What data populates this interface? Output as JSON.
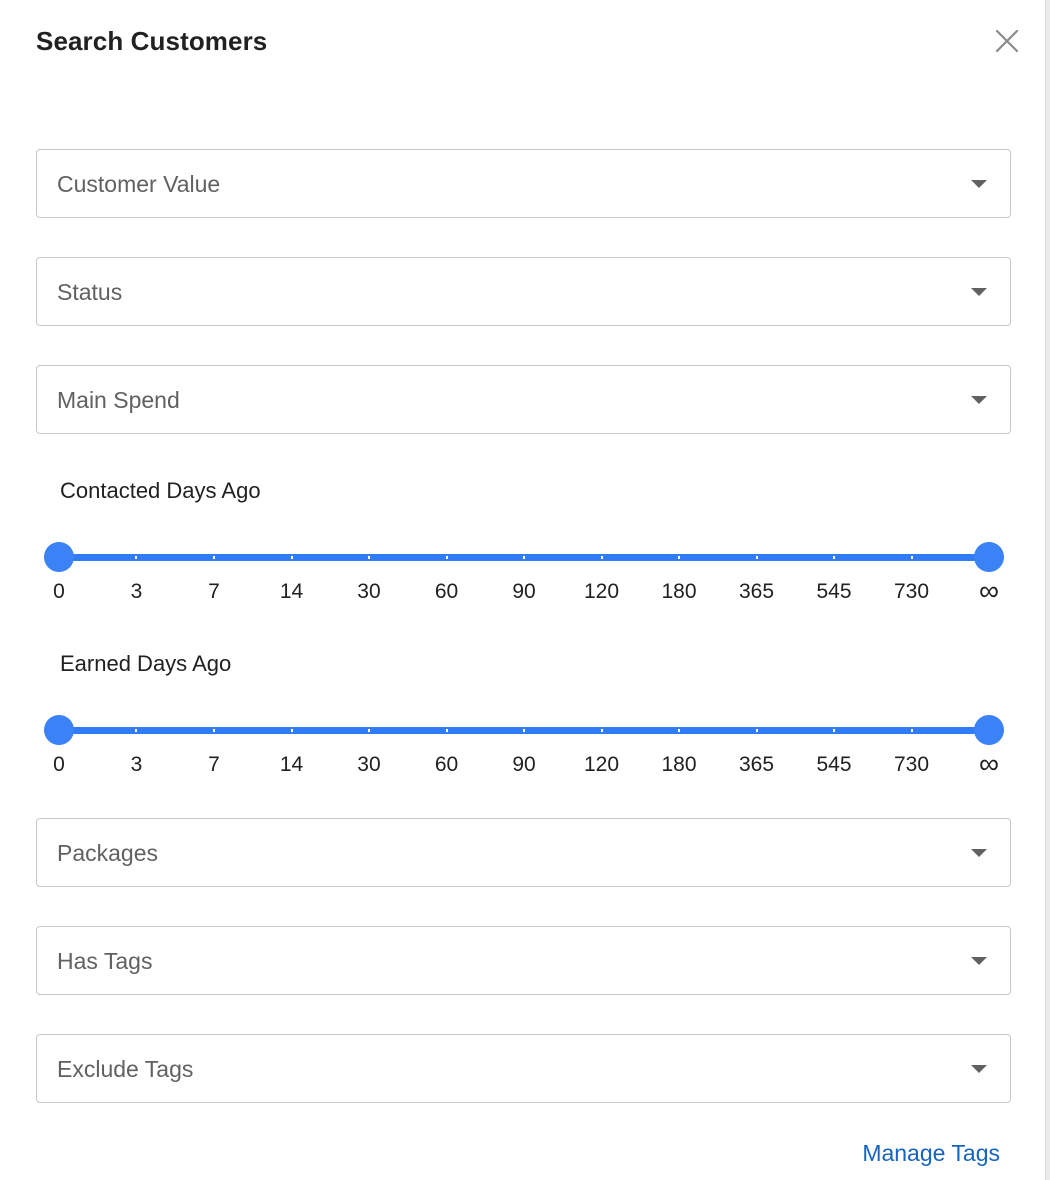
{
  "dialog": {
    "title": "Search Customers",
    "close_icon": "close-icon"
  },
  "filters": {
    "customer_value": {
      "label": "Customer Value",
      "icon": "chevron-down-icon"
    },
    "status": {
      "label": "Status",
      "icon": "chevron-down-icon"
    },
    "main_spend": {
      "label": "Main Spend",
      "icon": "chevron-down-icon"
    },
    "packages": {
      "label": "Packages",
      "icon": "chevron-down-icon"
    },
    "has_tags": {
      "label": "Has Tags",
      "icon": "chevron-down-icon"
    },
    "exclude_tags": {
      "label": "Exclude Tags",
      "icon": "chevron-down-icon"
    }
  },
  "contacted_slider": {
    "title": "Contacted Days Ago",
    "ticks": [
      "0",
      "3",
      "7",
      "14",
      "30",
      "60",
      "90",
      "120",
      "180",
      "365",
      "545",
      "730",
      "∞"
    ],
    "min_value": "0",
    "max_value": "∞"
  },
  "earned_slider": {
    "title": "Earned Days Ago",
    "ticks": [
      "0",
      "3",
      "7",
      "14",
      "30",
      "60",
      "90",
      "120",
      "180",
      "365",
      "545",
      "730",
      "∞"
    ],
    "min_value": "0",
    "max_value": "∞"
  },
  "footer": {
    "manage_tags": "Manage Tags"
  },
  "colors": {
    "accent": "#3b82f6",
    "link": "#1565c0",
    "border": "#c8c8c8",
    "placeholder": "#616161"
  }
}
